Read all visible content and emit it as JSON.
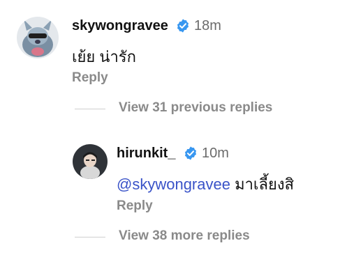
{
  "comment": {
    "username": "skywongravee",
    "time": "18m",
    "text": "เย้ย น่ารัก",
    "reply_label": "Reply",
    "verified_icon": "verified-badge-icon"
  },
  "view_previous": {
    "label": "View 31 previous replies"
  },
  "reply": {
    "username": "hirunkit_",
    "time": "10m",
    "mention": "@skywongravee",
    "text": " มาเลี้ยงสิ",
    "reply_label": "Reply",
    "verified_icon": "verified-badge-icon"
  },
  "view_more": {
    "label": "View 38 more replies"
  },
  "colors": {
    "mention": "#3a53c8",
    "verified": "#3897f0",
    "muted": "#8a8a8a"
  }
}
